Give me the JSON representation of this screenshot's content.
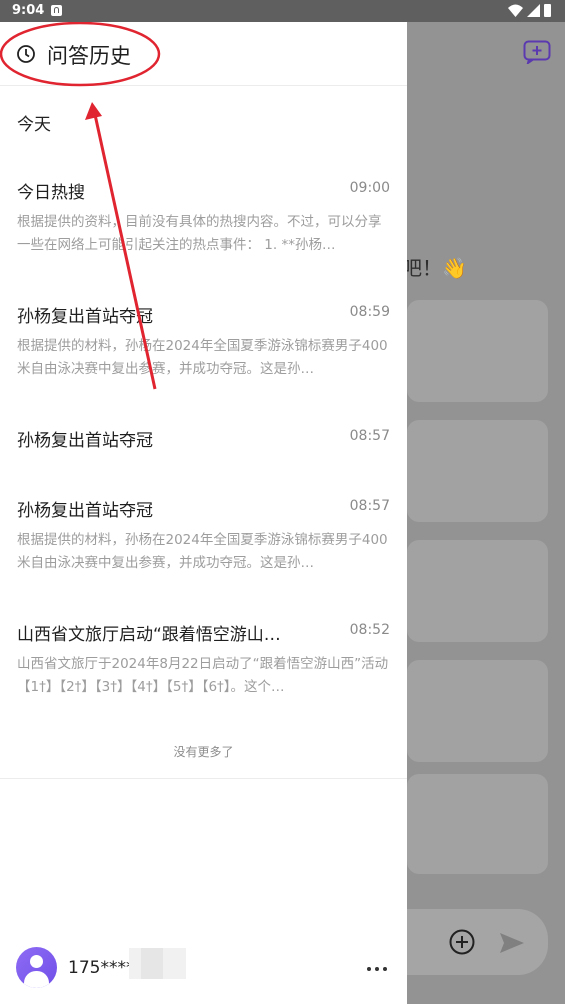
{
  "status_bar": {
    "time": "9:04"
  },
  "drawer": {
    "title": "问答历史",
    "section_label": "今天",
    "items": [
      {
        "title": "今日热搜",
        "time": "09:00",
        "preview": "根据提供的资料，目前没有具体的热搜内容。不过，可以分享一些在网络上可能引起关注的热点事件： 1. **孙杨…"
      },
      {
        "title": "孙杨复出首站夺冠",
        "time": "08:59",
        "preview": "根据提供的材料，孙杨在2024年全国夏季游泳锦标赛男子400米自由泳决赛中复出参赛，并成功夺冠。这是孙…"
      },
      {
        "title": "孙杨复出首站夺冠",
        "time": "08:57",
        "preview": ""
      },
      {
        "title": "孙杨复出首站夺冠",
        "time": "08:57",
        "preview": "根据提供的材料，孙杨在2024年全国夏季游泳锦标赛男子400米自由泳决赛中复出参赛，并成功夺冠。这是孙…"
      },
      {
        "title": "山西省文旅厅启动“跟着悟空游山…",
        "time": "08:52",
        "preview": "山西省文旅厅于2024年8月22日启动了“跟着悟空游山西”活动【1†】【2†】【3†】【4†】【5†】【6†】。这个…"
      }
    ],
    "no_more": "没有更多了",
    "user": {
      "name": "175****"
    }
  },
  "background": {
    "greeting_fragment": "吧！👋"
  },
  "colors": {
    "accent": "#7b4ff0",
    "annotation": "#e02430"
  }
}
